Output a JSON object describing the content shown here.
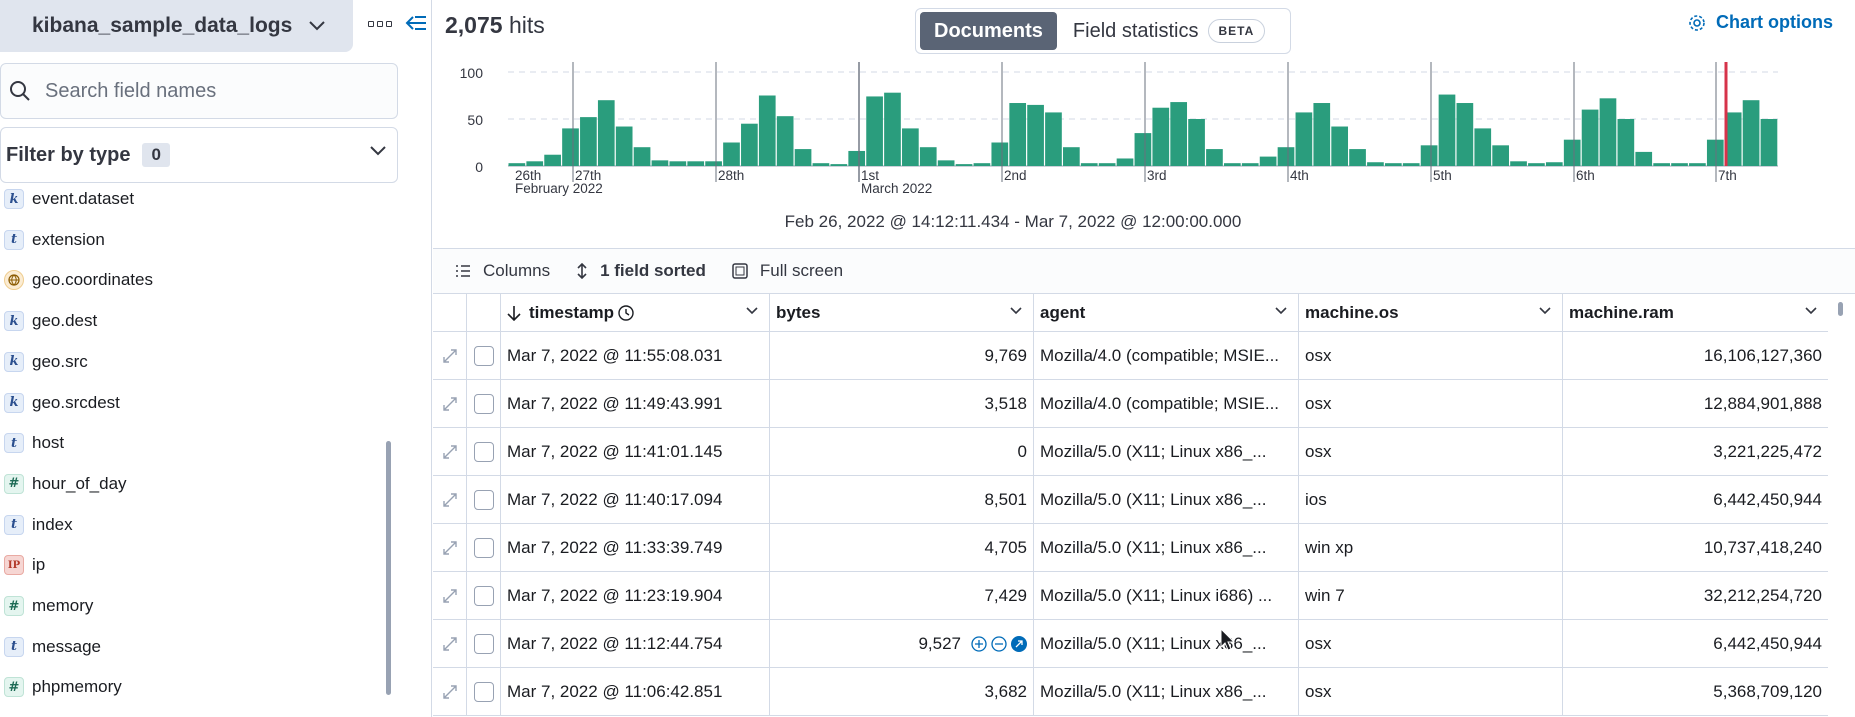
{
  "sidebar": {
    "index_pattern": "kibana_sample_data_logs",
    "search": {
      "placeholder": "Search field names",
      "value": ""
    },
    "filter_by_type": {
      "label": "Filter by type",
      "count": "0"
    },
    "fields": [
      {
        "name": "event.dataset",
        "type": "k"
      },
      {
        "name": "extension",
        "type": "t"
      },
      {
        "name": "geo.coordinates",
        "type": "geo"
      },
      {
        "name": "geo.dest",
        "type": "k"
      },
      {
        "name": "geo.src",
        "type": "k"
      },
      {
        "name": "geo.srcdest",
        "type": "k"
      },
      {
        "name": "host",
        "type": "t"
      },
      {
        "name": "hour_of_day",
        "type": "#"
      },
      {
        "name": "index",
        "type": "t"
      },
      {
        "name": "ip",
        "type": "IP"
      },
      {
        "name": "memory",
        "type": "#"
      },
      {
        "name": "message",
        "type": "t"
      },
      {
        "name": "phpmemory",
        "type": "#"
      }
    ]
  },
  "main": {
    "hits_count": "2,075",
    "hits_label": "hits",
    "tabs": {
      "documents": "Documents",
      "field_stats": "Field statistics",
      "beta": "BETA"
    },
    "chart_options": "Chart options",
    "time_range": "Feb 26, 2022 @ 14:12:11.434 - Mar 7, 2022 @ 12:00:00.000",
    "toolbar": {
      "columns": "Columns",
      "sorted": "1 field sorted",
      "fullscreen": "Full screen"
    },
    "columns": [
      "timestamp",
      "bytes",
      "agent",
      "machine.os",
      "machine.ram"
    ],
    "rows": [
      {
        "timestamp": "Mar 7, 2022 @ 11:55:08.031",
        "bytes": "9,769",
        "agent": "Mozilla/4.0 (compatible; MSIE...",
        "os": "osx",
        "ram": "16,106,127,360"
      },
      {
        "timestamp": "Mar 7, 2022 @ 11:49:43.991",
        "bytes": "3,518",
        "agent": "Mozilla/4.0 (compatible; MSIE...",
        "os": "osx",
        "ram": "12,884,901,888"
      },
      {
        "timestamp": "Mar 7, 2022 @ 11:41:01.145",
        "bytes": "0",
        "agent": "Mozilla/5.0 (X11; Linux x86_...",
        "os": "osx",
        "ram": "3,221,225,472"
      },
      {
        "timestamp": "Mar 7, 2022 @ 11:40:17.094",
        "bytes": "8,501",
        "agent": "Mozilla/5.0 (X11; Linux x86_...",
        "os": "ios",
        "ram": "6,442,450,944"
      },
      {
        "timestamp": "Mar 7, 2022 @ 11:33:39.749",
        "bytes": "4,705",
        "agent": "Mozilla/5.0 (X11; Linux x86_...",
        "os": "win xp",
        "ram": "10,737,418,240"
      },
      {
        "timestamp": "Mar 7, 2022 @ 11:23:19.904",
        "bytes": "7,429",
        "agent": "Mozilla/5.0 (X11; Linux i686) ...",
        "os": "win 7",
        "ram": "32,212,254,720"
      },
      {
        "timestamp": "Mar 7, 2022 @ 11:12:44.754",
        "bytes": "9,527",
        "agent": "Mozilla/5.0 (X11; Linux x86_...",
        "os": "osx",
        "ram": "6,442,450,944"
      },
      {
        "timestamp": "Mar 7, 2022 @ 11:06:42.851",
        "bytes": "3,682",
        "agent": "Mozilla/5.0 (X11; Linux x86_...",
        "os": "osx",
        "ram": "5,368,709,120"
      }
    ]
  },
  "colors": {
    "bar": "#2a9d7d",
    "accent": "#006bb8",
    "marker": "#d6334a"
  },
  "chart_data": {
    "type": "bar",
    "ylim": [
      0,
      100
    ],
    "yticks": [
      "100",
      "50",
      "0"
    ],
    "day_labels": [
      "26th",
      "27th",
      "28th",
      "1st",
      "2nd",
      "3rd",
      "4th",
      "5th",
      "6th",
      "7th"
    ],
    "sub_labels": [
      "February 2022",
      "March 2022"
    ],
    "values": [
      3,
      5,
      12,
      40,
      52,
      70,
      42,
      20,
      6,
      5,
      5,
      5,
      25,
      45,
      75,
      53,
      18,
      3,
      2,
      16,
      74,
      78,
      40,
      20,
      6,
      2,
      3,
      25,
      67,
      65,
      57,
      20,
      3,
      3,
      8,
      35,
      62,
      68,
      50,
      18,
      3,
      3,
      10,
      20,
      57,
      67,
      42,
      18,
      4,
      3,
      3,
      22,
      76,
      67,
      40,
      22,
      5,
      3,
      4,
      28,
      60,
      72,
      50,
      15,
      3,
      3,
      3,
      28,
      57,
      70,
      50
    ]
  }
}
